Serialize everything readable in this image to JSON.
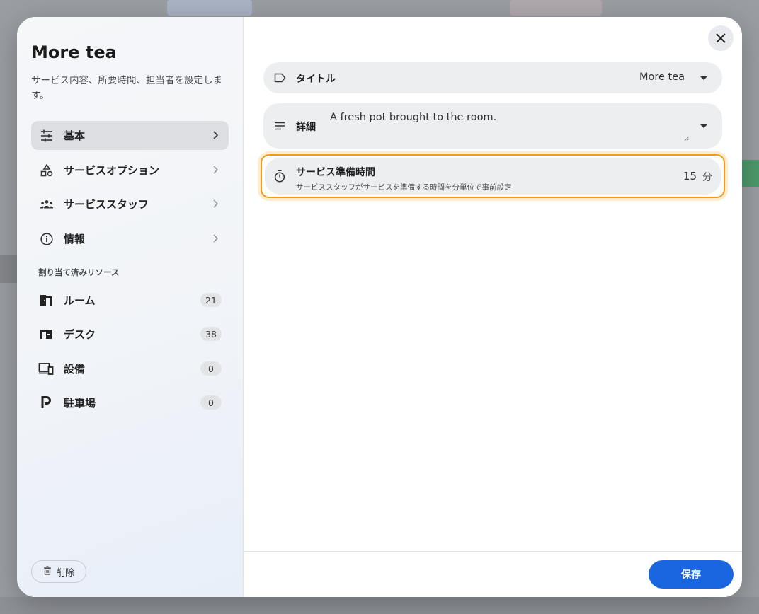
{
  "dialog": {
    "title": "More tea",
    "description": "サービス内容、所要時間、担当者を設定します。"
  },
  "nav": {
    "items": [
      {
        "label": "基本",
        "icon": "sliders-icon",
        "active": true
      },
      {
        "label": "サービスオプション",
        "icon": "shapes-icon",
        "active": false
      },
      {
        "label": "サービススタッフ",
        "icon": "people-icon",
        "active": false
      },
      {
        "label": "情報",
        "icon": "info-icon",
        "active": false
      }
    ]
  },
  "resources": {
    "section_label": "割り当て済みリソース",
    "items": [
      {
        "label": "ルーム",
        "count": "21",
        "icon": "door-icon"
      },
      {
        "label": "デスク",
        "count": "38",
        "icon": "desk-icon"
      },
      {
        "label": "設備",
        "count": "0",
        "icon": "devices-icon"
      },
      {
        "label": "駐車場",
        "count": "0",
        "icon": "parking-icon"
      }
    ]
  },
  "sidebar_footer": {
    "delete_label": "削除"
  },
  "form": {
    "title_field": {
      "label": "タイトル",
      "value": "More tea"
    },
    "detail_field": {
      "label": "詳細",
      "value": "A fresh pot brought to the room."
    },
    "prep_field": {
      "label": "サービス準備時間",
      "sublabel": "サービススタッフがサービスを準備する時間を分単位で事前設定",
      "value": "15",
      "unit": "分"
    }
  },
  "footer": {
    "save_label": "保存"
  },
  "colors": {
    "accent": "#1a66e0",
    "focus": "#f29a1b"
  }
}
